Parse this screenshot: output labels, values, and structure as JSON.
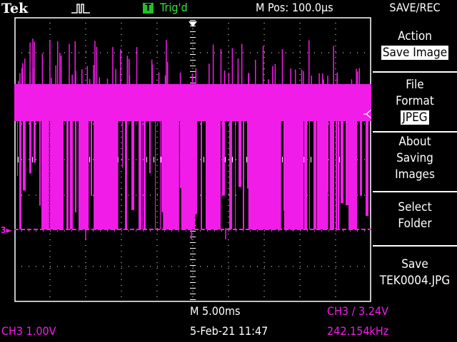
{
  "header": {
    "brand": "Tek",
    "trigger_badge": "T",
    "trigger_state": "Trig'd",
    "horizontal_position": "M Pos: 100.0µs",
    "menu_title": "SAVE/REC"
  },
  "menu": {
    "items": [
      {
        "lines": [
          "Action"
        ],
        "value": "Save Image"
      },
      {
        "lines": [
          "File",
          "Format"
        ],
        "value": "JPEG"
      },
      {
        "lines": [
          "About",
          "Saving",
          "Images"
        ]
      },
      {
        "lines": [
          "Select",
          "Folder"
        ]
      },
      {
        "lines": [
          "Save",
          "TEK0004.JPG"
        ]
      }
    ]
  },
  "channel": {
    "marker": "3",
    "scale": "CH3  1.00V"
  },
  "status": {
    "timebase": "M 5.00ms",
    "datetime": "5-Feb-21 11:47",
    "trigger": "CH3 ∕ 3.24V",
    "frequency": "242.154kHz"
  },
  "colors": {
    "trace": "#f21ce8",
    "grid": "#ffffff",
    "trigger_ok": "#22c02a"
  }
}
